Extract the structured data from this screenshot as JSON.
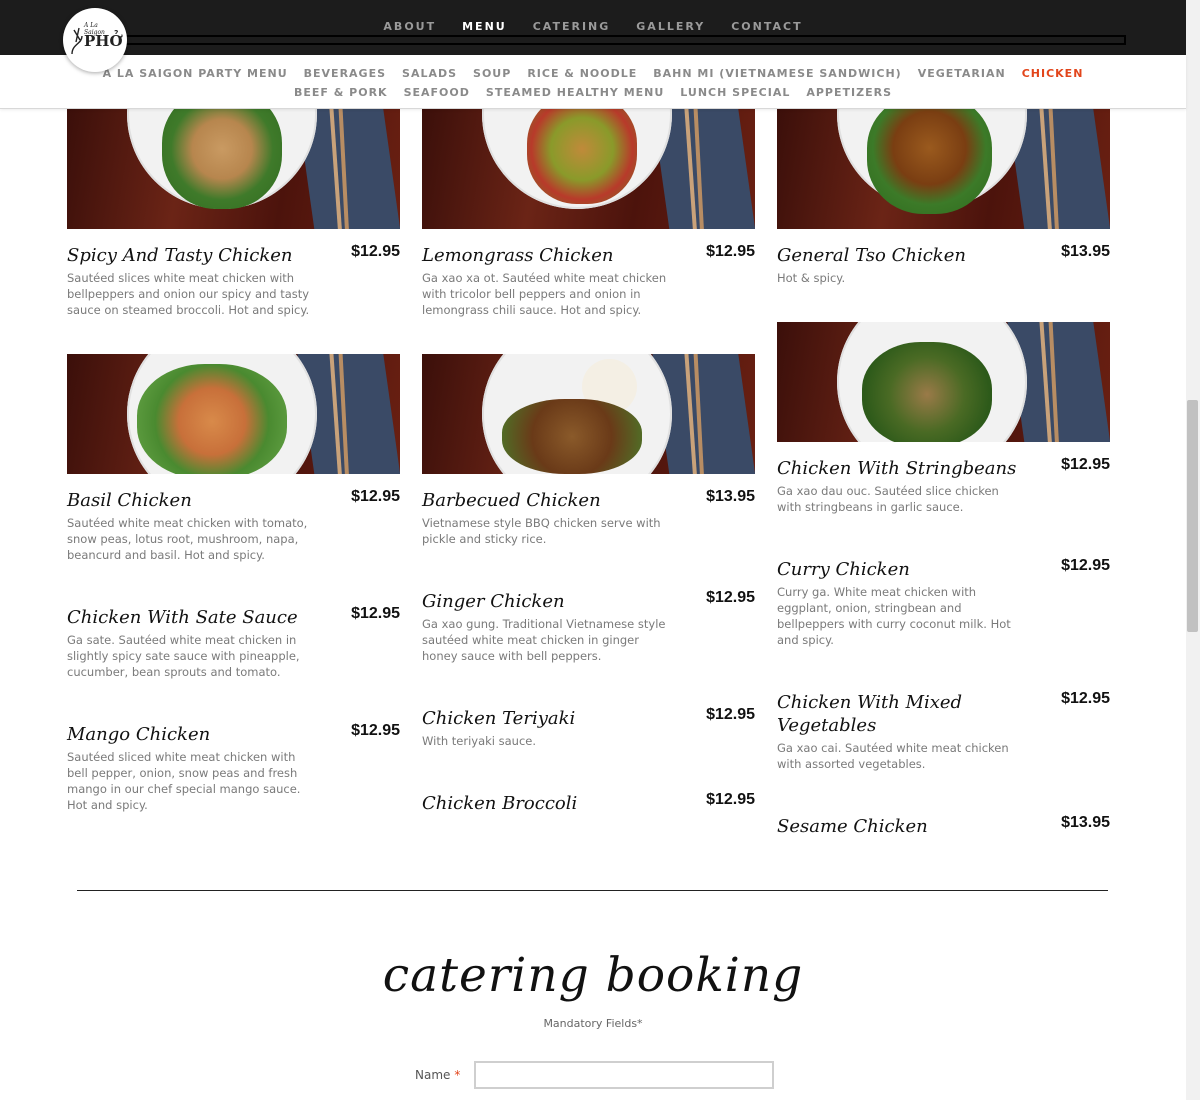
{
  "logo": {
    "small_text": "A La Saigon",
    "main_text": "PHỞ"
  },
  "top_nav": [
    {
      "label": "ABOUT",
      "active": false
    },
    {
      "label": "MENU",
      "active": true
    },
    {
      "label": "CATERING",
      "active": false
    },
    {
      "label": "GALLERY",
      "active": false
    },
    {
      "label": "CONTACT",
      "active": false
    }
  ],
  "categories_row1": [
    "A LA SAIGON PARTY MENU",
    "BEVERAGES",
    "SALADS",
    "SOUP",
    "RICE & NOODLE",
    "BAHN MI (VIETNAMESE SANDWICH)",
    "VEGETARIAN",
    "CHICKEN"
  ],
  "categories_row2": [
    "BEEF & PORK",
    "SEAFOOD",
    "STEAMED HEALTHY MENU",
    "LUNCH SPECIAL",
    "APPETIZERS"
  ],
  "active_category": "CHICKEN",
  "items": [
    {
      "name": "Spicy And Tasty Chicken",
      "price": "$12.95",
      "desc": "Sautéed slices white meat chicken with bellpeppers and onion our spicy and tasty sauce on steamed broccoli. Hot and spicy."
    },
    {
      "name": "Lemongrass Chicken",
      "price": "$12.95",
      "desc": "Ga xao xa ot. Sautéed white meat chicken with tricolor bell peppers and onion in lemongrass chili sauce. Hot and spicy."
    },
    {
      "name": "General Tso Chicken",
      "price": "$13.95",
      "desc": "Hot & spicy."
    },
    {
      "name": "Basil Chicken",
      "price": "$12.95",
      "desc": "Sautéed white meat chicken with tomato, snow peas, lotus root, mushroom, napa, beancurd and basil. Hot and spicy."
    },
    {
      "name": "Barbecued Chicken",
      "price": "$13.95",
      "desc": "Vietnamese style BBQ chicken serve with pickle and sticky rice."
    },
    {
      "name": "Chicken With Stringbeans",
      "price": "$12.95",
      "desc": "Ga xao dau ouc. Sautéed slice chicken with stringbeans in garlic sauce."
    },
    {
      "name": "Chicken With Sate Sauce",
      "price": "$12.95",
      "desc": "Ga sate. Sautéed white meat chicken in slightly spicy sate sauce with pineapple, cucumber, bean sprouts and tomato."
    },
    {
      "name": "Ginger Chicken",
      "price": "$12.95",
      "desc": "Ga xao gung. Traditional Vietnamese style sautéed white meat chicken in ginger honey sauce with bell peppers."
    },
    {
      "name": "Curry Chicken",
      "price": "$12.95",
      "desc": "Curry ga. White meat chicken with eggplant, onion, stringbean and bellpeppers with curry coconut milk. Hot and spicy."
    },
    {
      "name": "Mango Chicken",
      "price": "$12.95",
      "desc": "Sautéed sliced white meat chicken with bell pepper, onion, snow peas and fresh mango in our chef special mango sauce. Hot and spicy."
    },
    {
      "name": "Chicken Teriyaki",
      "price": "$12.95",
      "desc": "With teriyaki sauce."
    },
    {
      "name": "Chicken With Mixed Vegetables",
      "price": "$12.95",
      "desc": "Ga xao cai. Sautéed white meat chicken with assorted vegetables."
    },
    {
      "name": "Chicken Broccoli",
      "price": "$12.95",
      "desc": ""
    },
    {
      "name": "Sesame Chicken",
      "price": "$13.95",
      "desc": ""
    }
  ],
  "booking": {
    "title": "catering booking",
    "mandatory_note": "Mandatory Fields*",
    "name_label": "Name",
    "required_mark": "*",
    "name_value": ""
  },
  "colors": {
    "topbar": "#1c1c1c",
    "accent": "#e2451b"
  }
}
